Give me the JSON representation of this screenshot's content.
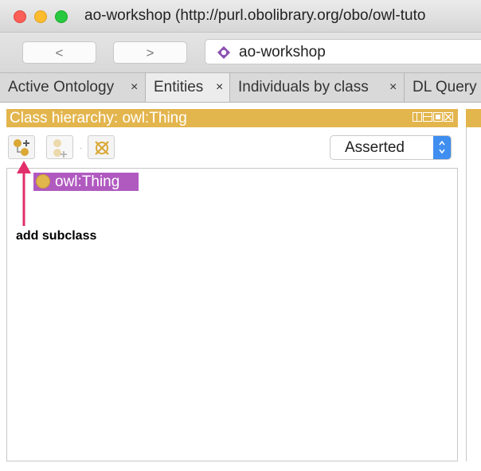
{
  "window": {
    "title": "ao-workshop (http://purl.obolibrary.org/obo/owl-tuto"
  },
  "toolbar": {
    "back_label": "<",
    "forward_label": ">",
    "ontology_name": "ao-workshop",
    "ontology_icon": "ontology-diamond-icon"
  },
  "tabs": [
    {
      "label": "Active Ontology",
      "close": "×",
      "active": false
    },
    {
      "label": "Entities",
      "close": "×",
      "active": true
    },
    {
      "label": "Individuals by class",
      "close": "×",
      "active": false
    },
    {
      "label": "DL Query",
      "close": "",
      "active": false
    }
  ],
  "class_hierarchy": {
    "title": "Class hierarchy: owl:Thing",
    "buttons": [
      {
        "name": "add-subclass-icon",
        "enabled": true
      },
      {
        "name": "add-sibling-icon",
        "enabled": false
      },
      {
        "name": "delete-class-icon",
        "enabled": true
      }
    ],
    "view_mode": "Asserted",
    "tree": [
      {
        "label": "owl:Thing",
        "selected": true
      }
    ]
  },
  "annotation": {
    "text": "add subclass"
  },
  "colors": {
    "panel_header": "#e3b54d",
    "selection": "#b05ac0",
    "class_icon": "#e0b64d",
    "arrow": "#e22f6b",
    "select_arrow": "#3f8ef0"
  }
}
